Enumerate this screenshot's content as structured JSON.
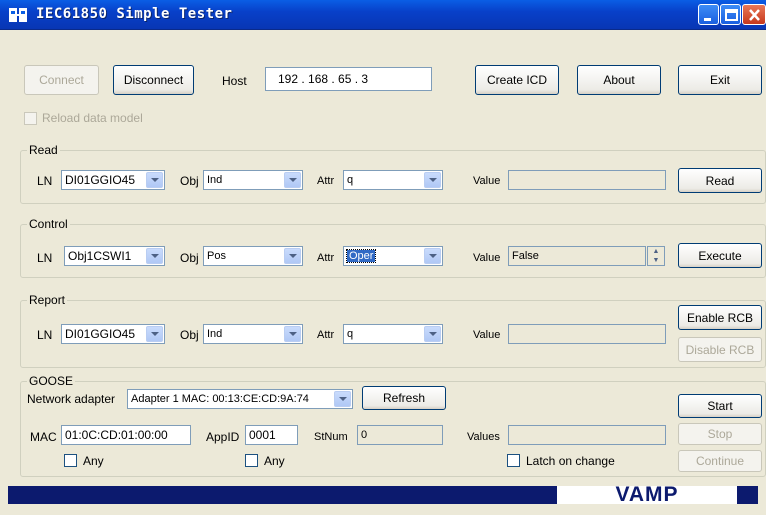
{
  "window": {
    "title": "IEC61850 Simple Tester"
  },
  "toolbar": {
    "connect": "Connect",
    "disconnect": "Disconnect",
    "host_label": "Host",
    "host_value": "192 . 168 . 65 . 3",
    "create_icd": "Create ICD",
    "about": "About",
    "exit": "Exit",
    "reload_label": "Reload data model"
  },
  "read": {
    "title": "Read",
    "ln_label": "LN",
    "ln_value": "DI01GGIO45",
    "obj_label": "Obj",
    "obj_value": "Ind",
    "attr_label": "Attr",
    "attr_value": "q",
    "value_label": "Value",
    "value": "",
    "button": "Read"
  },
  "control": {
    "title": "Control",
    "ln_label": "LN",
    "ln_value": "Obj1CSWI1",
    "obj_label": "Obj",
    "obj_value": "Pos",
    "attr_label": "Attr",
    "attr_value": "Oper",
    "value_label": "Value",
    "value": "False",
    "button": "Execute"
  },
  "report": {
    "title": "Report",
    "ln_label": "LN",
    "ln_value": "DI01GGIO45",
    "obj_label": "Obj",
    "obj_value": "Ind",
    "attr_label": "Attr",
    "attr_value": "q",
    "value_label": "Value",
    "value": "",
    "enable": "Enable RCB",
    "disable": "Disable RCB"
  },
  "goose": {
    "title": "GOOSE",
    "adapter_label": "Network adapter",
    "adapter_value": "Adapter 1 MAC: 00:13:CE:CD:9A:74",
    "refresh": "Refresh",
    "mac_label": "MAC",
    "mac_value": "01:0C:CD:01:00:00",
    "appid_label": "AppID",
    "appid_value": "0001",
    "stnum_label": "StNum",
    "stnum_value": "0",
    "values_label": "Values",
    "values_value": "",
    "any1": "Any",
    "any2": "Any",
    "latch": "Latch on change",
    "start": "Start",
    "stop": "Stop",
    "continue": "Continue"
  },
  "brand": {
    "logo_text": "VAMP"
  }
}
